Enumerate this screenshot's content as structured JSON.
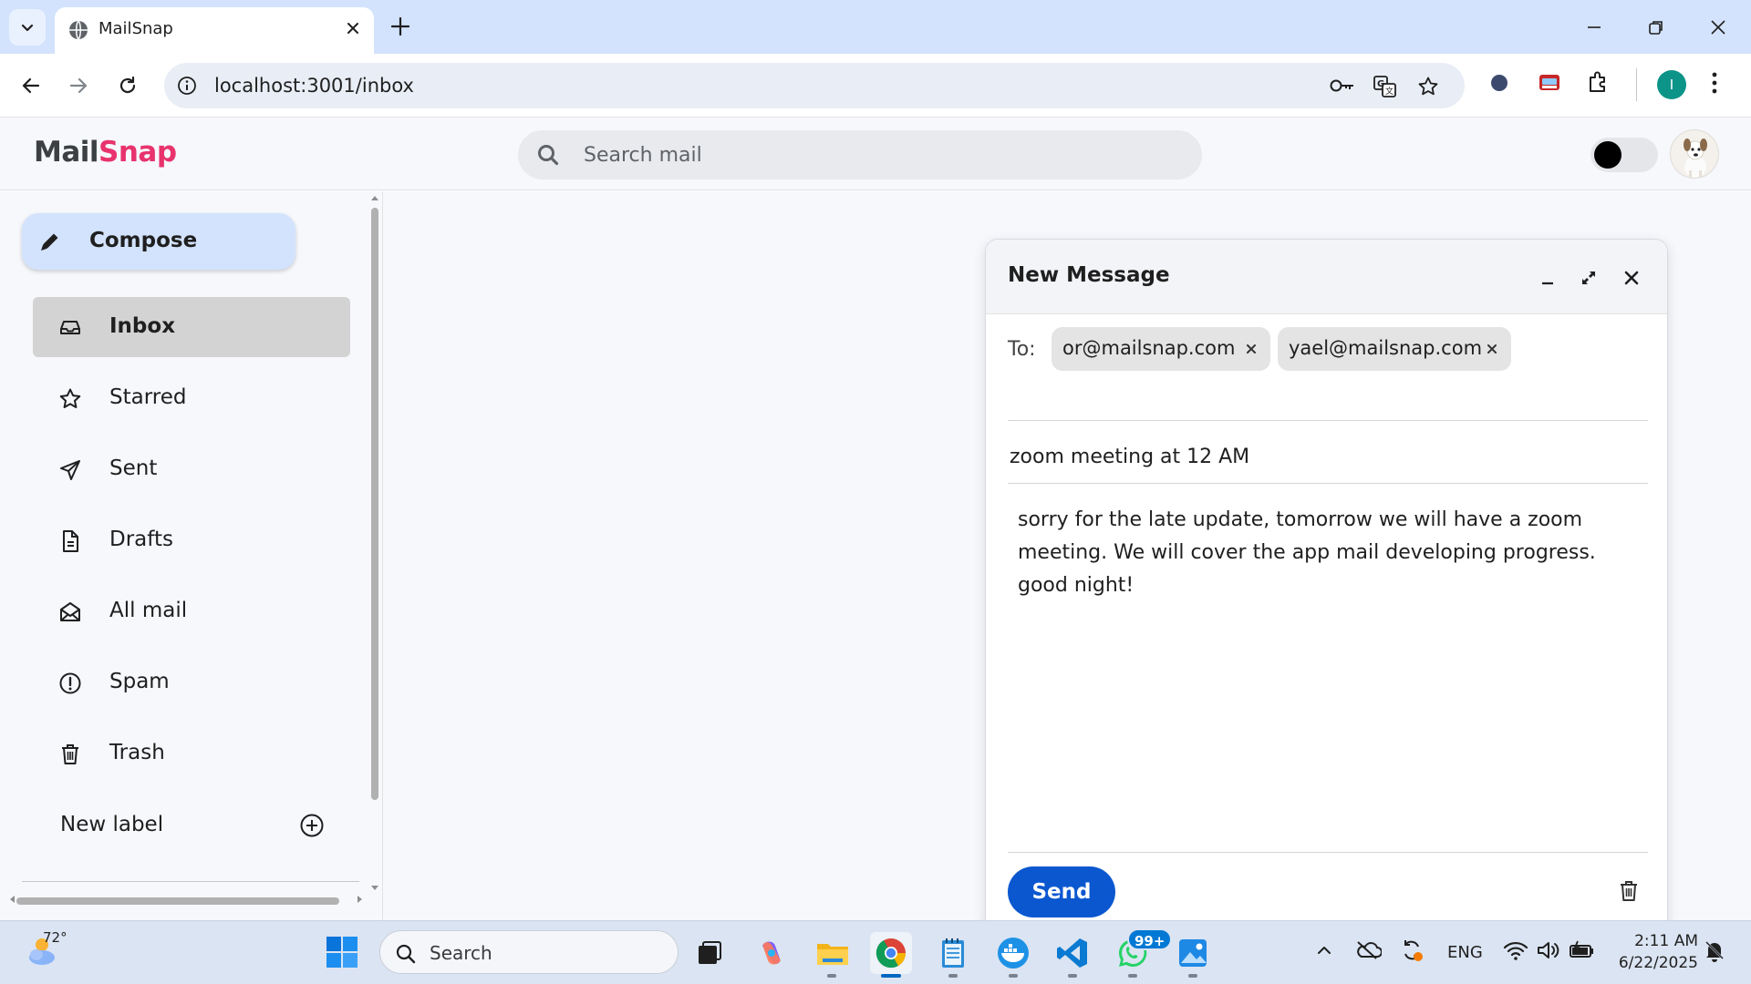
{
  "browser": {
    "tab_title": "MailSnap",
    "url": "localhost:3001/inbox",
    "profile_initial": "I"
  },
  "app": {
    "logo_part1": "Mail",
    "logo_part2": "Snap",
    "search_placeholder": "Search mail",
    "colors": {
      "brand_pink": "#e8336d",
      "compose_bg": "#d3e3fd",
      "send_blue": "#0b57d0"
    }
  },
  "sidebar": {
    "compose_label": "Compose",
    "items": [
      {
        "label": "Inbox",
        "icon": "inbox-icon",
        "active": true
      },
      {
        "label": "Starred",
        "icon": "star-icon"
      },
      {
        "label": "Sent",
        "icon": "send-icon"
      },
      {
        "label": "Drafts",
        "icon": "draft-icon"
      },
      {
        "label": "All mail",
        "icon": "all-mail-icon"
      },
      {
        "label": "Spam",
        "icon": "spam-icon"
      },
      {
        "label": "Trash",
        "icon": "trash-icon"
      }
    ],
    "new_label": "New label"
  },
  "compose_window": {
    "title": "New Message",
    "to_label": "To:",
    "recipients": [
      "or@mailsnap.com",
      "yael@mailsnap.com"
    ],
    "subject": "zoom meeting at 12 AM",
    "body_lines": [
      "sorry for the late update, tomorrow we will have a zoom",
      "meeting. We will cover the app mail developing progress.",
      "good night!"
    ],
    "send_label": "Send"
  },
  "taskbar": {
    "temperature": "72°",
    "search_label": "Search",
    "whatsapp_badge": "99+",
    "language": "ENG",
    "time": "2:11 AM",
    "date": "6/22/2025"
  }
}
